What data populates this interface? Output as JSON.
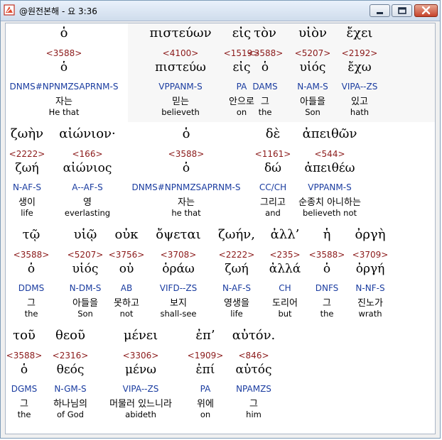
{
  "window": {
    "title": "@원전본해 - 요 3:36"
  },
  "verse": {
    "lines": [
      [
        {
          "greek": "ὁ",
          "strong": "<3588>",
          "lemma": "ὁ",
          "parse": "DNMS#NPNMZSAPRNM-S",
          "korean": "자는",
          "english": "He that"
        },
        {
          "greek": "πιστεύων",
          "strong": "<4100>",
          "lemma": "πιστεύω",
          "parse": "VPPANM-S",
          "korean": "믿는",
          "english": "believeth"
        },
        {
          "greek": "εἰς",
          "strong": "<1519>",
          "lemma": "εἰς",
          "parse": "PA",
          "korean": "안으로",
          "english": "on"
        },
        {
          "greek": "τὸν",
          "strong": "<3588>",
          "lemma": "ὁ",
          "parse": "DAMS",
          "korean": "그",
          "english": "the"
        },
        {
          "greek": "υἱὸν",
          "strong": "<5207>",
          "lemma": "υἱός",
          "parse": "N-AM-S",
          "korean": "아들을",
          "english": "Son"
        },
        {
          "greek": "ἔχει",
          "strong": "<2192>",
          "lemma": "ἔχω",
          "parse": "VIPA--ZS",
          "korean": "있고",
          "english": "hath"
        }
      ],
      [
        {
          "greek": "ζωὴν",
          "strong": "<2222>",
          "lemma": "ζωή",
          "parse": "N-AF-S",
          "korean": "생이",
          "english": "life"
        },
        {
          "greek": "αἰώνιον·",
          "strong": "<166>",
          "lemma": "αἰώνιος",
          "parse": "A--AF-S",
          "korean": "영",
          "english": "everlasting"
        },
        {
          "greek": "ὁ",
          "strong": "<3588>",
          "lemma": "ὁ",
          "parse": "DNMS#NPNMZSAPRNM-S",
          "korean": "자는",
          "english": "he that"
        },
        {
          "greek": "δὲ",
          "strong": "<1161>",
          "lemma": "δώ",
          "parse": "CC/CH",
          "korean": "그리고",
          "english": "and"
        },
        {
          "greek": "ἀπειθῶν",
          "strong": "<544>",
          "lemma": "ἀπειθέω",
          "parse": "VPPANM-S",
          "korean": "순종치 아니하는",
          "english": "believeth not"
        }
      ],
      [
        {
          "greek": "τῷ",
          "strong": "<3588>",
          "lemma": "ὁ",
          "parse": "DDMS",
          "korean": "그",
          "english": "the"
        },
        {
          "greek": "υἱῷ",
          "strong": "<5207>",
          "lemma": "υἱός",
          "parse": "N-DM-S",
          "korean": "아들을",
          "english": "Son"
        },
        {
          "greek": "οὐκ",
          "strong": "<3756>",
          "lemma": "οὐ",
          "parse": "AB",
          "korean": "못하고",
          "english": "not"
        },
        {
          "greek": "ὄψεται",
          "strong": "<3708>",
          "lemma": "ὁράω",
          "parse": "VIFD--ZS",
          "korean": "보지",
          "english": "shall-see"
        },
        {
          "greek": "ζωήν,",
          "strong": "<2222>",
          "lemma": "ζωή",
          "parse": "N-AF-S",
          "korean": "영생을",
          "english": "life"
        },
        {
          "greek": "ἀλλ’",
          "strong": "<235>",
          "lemma": "ἀλλά",
          "parse": "CH",
          "korean": "도리어",
          "english": "but"
        },
        {
          "greek": "ἡ",
          "strong": "<3588>",
          "lemma": "ὁ",
          "parse": "DNFS",
          "korean": "그",
          "english": "the"
        },
        {
          "greek": "ὀργὴ",
          "strong": "<3709>",
          "lemma": "ὀργή",
          "parse": "N-NF-S",
          "korean": "진노가",
          "english": "wrath"
        }
      ],
      [
        {
          "greek": "τοῦ",
          "strong": "<3588>",
          "lemma": "ὁ",
          "parse": "DGMS",
          "korean": "그",
          "english": "the"
        },
        {
          "greek": "θεοῦ",
          "strong": "<2316>",
          "lemma": "θεός",
          "parse": "N-GM-S",
          "korean": "하나님의",
          "english": "of God"
        },
        {
          "greek": "μένει",
          "strong": "<3306>",
          "lemma": "μένω",
          "parse": "VIPA--ZS",
          "korean": "머물러 있느니라",
          "english": "abideth"
        },
        {
          "greek": "ἐπ’",
          "strong": "<1909>",
          "lemma": "ἐπί",
          "parse": "PA",
          "korean": "위에",
          "english": "on"
        },
        {
          "greek": "αὐτόν.",
          "strong": "<846>",
          "lemma": "αὐτός",
          "parse": "NPAMZS",
          "korean": "그",
          "english": "him"
        }
      ]
    ]
  }
}
